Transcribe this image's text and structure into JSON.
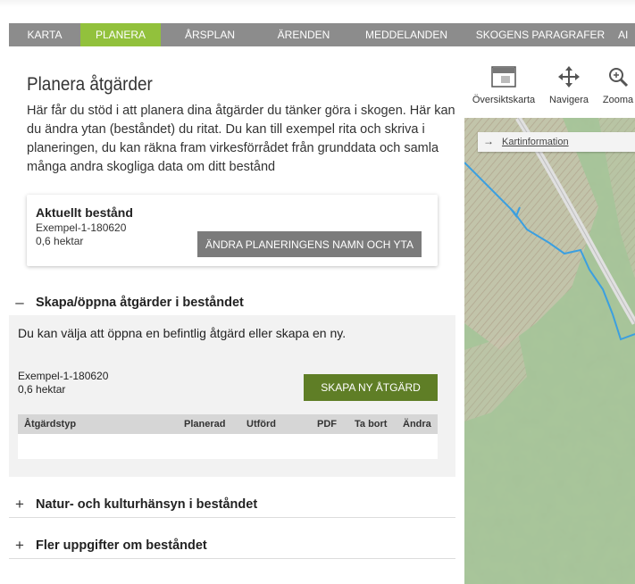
{
  "nav": {
    "items": [
      "KARTA",
      "PLANERA",
      "ÅRSPLAN",
      "ÄRENDEN",
      "MEDDELANDEN",
      "SKOGENS PARAGRAFER",
      "AI"
    ],
    "active": "PLANERA"
  },
  "page": {
    "title": "Planera åtgärder",
    "intro": "Här får du stöd i att planera dina åtgärder du tänker göra i skogen. Här kan du ändra ytan (beståndet) du ritat. Du kan till exempel rita och skriva i planeringen, du kan räkna fram virkesförrådet från grunddata och samla många andra skogliga data om ditt bestånd"
  },
  "current_stand": {
    "heading": "Aktuellt bestånd",
    "name": "Exempel-1-180620",
    "area": "0,6 hektar",
    "rename_button": "ÄNDRA PLANERINGENS NAMN OCH YTA"
  },
  "sections": {
    "actions": {
      "sign": "–",
      "title": "Skapa/öppna åtgärder i beståndet",
      "description": "Du kan välja att öppna en befintlig åtgärd eller skapa en ny.",
      "stand_name": "Exempel-1-180620",
      "stand_area": "0,6 hektar",
      "new_button": "SKAPA NY ÅTGÄRD",
      "columns": [
        "Åtgärdstyp",
        "Planerad",
        "Utförd",
        "PDF",
        "Ta bort",
        "Ändra"
      ]
    },
    "nature": {
      "sign": "+",
      "title": "Natur- och kulturhänsyn i beståndet"
    },
    "more": {
      "sign": "+",
      "title": "Fler uppgifter om beståndet"
    }
  },
  "map": {
    "tools": [
      "Översiktskarta",
      "Navigera",
      "Zooma"
    ],
    "tool_icons": [
      "overview-map-icon",
      "move-arrows-icon",
      "zoom-magnifier-icon"
    ],
    "kartinfo_label": "Kartinformation",
    "colors": {
      "terrain": "#a9c69b",
      "river": "#3b9fe0",
      "road": "#d9d9d9"
    }
  },
  "colors": {
    "nav_bg": "#8c8c8c",
    "nav_active": "#92c13c",
    "primary_button": "#5f7e26",
    "secondary_button": "#7b7b7b"
  }
}
